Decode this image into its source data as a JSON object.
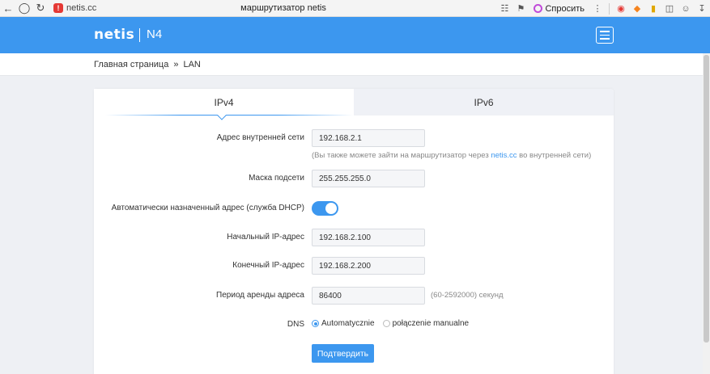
{
  "browser": {
    "url": "netis.cc",
    "title": "маршрутизатор netis",
    "ask_label": "Спросить"
  },
  "header": {
    "logo": "netis",
    "model": "N4"
  },
  "breadcrumb": {
    "home": "Главная страница",
    "separator": "»",
    "current": "LAN"
  },
  "tabs": [
    {
      "label": "IPv4",
      "active": true
    },
    {
      "label": "IPv6",
      "active": false
    }
  ],
  "form": {
    "lan_ip": {
      "label": "Адрес внутренней сети",
      "value": "192.168.2.1"
    },
    "lan_hint": {
      "prefix": "(Вы также можете зайти на маршрутизатор через ",
      "link": "netis.cc",
      "suffix": " во внутренней сети)"
    },
    "netmask": {
      "label": "Маска подсети",
      "value": "255.255.255.0"
    },
    "dhcp": {
      "label": "Автоматически назначенный адрес (служба DHCP)",
      "enabled": true
    },
    "start_ip": {
      "label": "Начальный IP-адрес",
      "value": "192.168.2.100"
    },
    "end_ip": {
      "label": "Конечный IP-адрес",
      "value": "192.168.2.200"
    },
    "lease": {
      "label": "Период аренды адреса",
      "value": "86400",
      "hint": "(60-2592000) секунд"
    },
    "dns": {
      "label": "DNS",
      "options": [
        {
          "label": "Automatycznie",
          "checked": true
        },
        {
          "label": "połączenie manualne",
          "checked": false
        }
      ]
    },
    "submit_label": "Подтвердить"
  },
  "colors": {
    "accent": "#3c97ef",
    "page_bg": "#eef0f4",
    "tab_inactive_bg": "#eff1f6"
  }
}
